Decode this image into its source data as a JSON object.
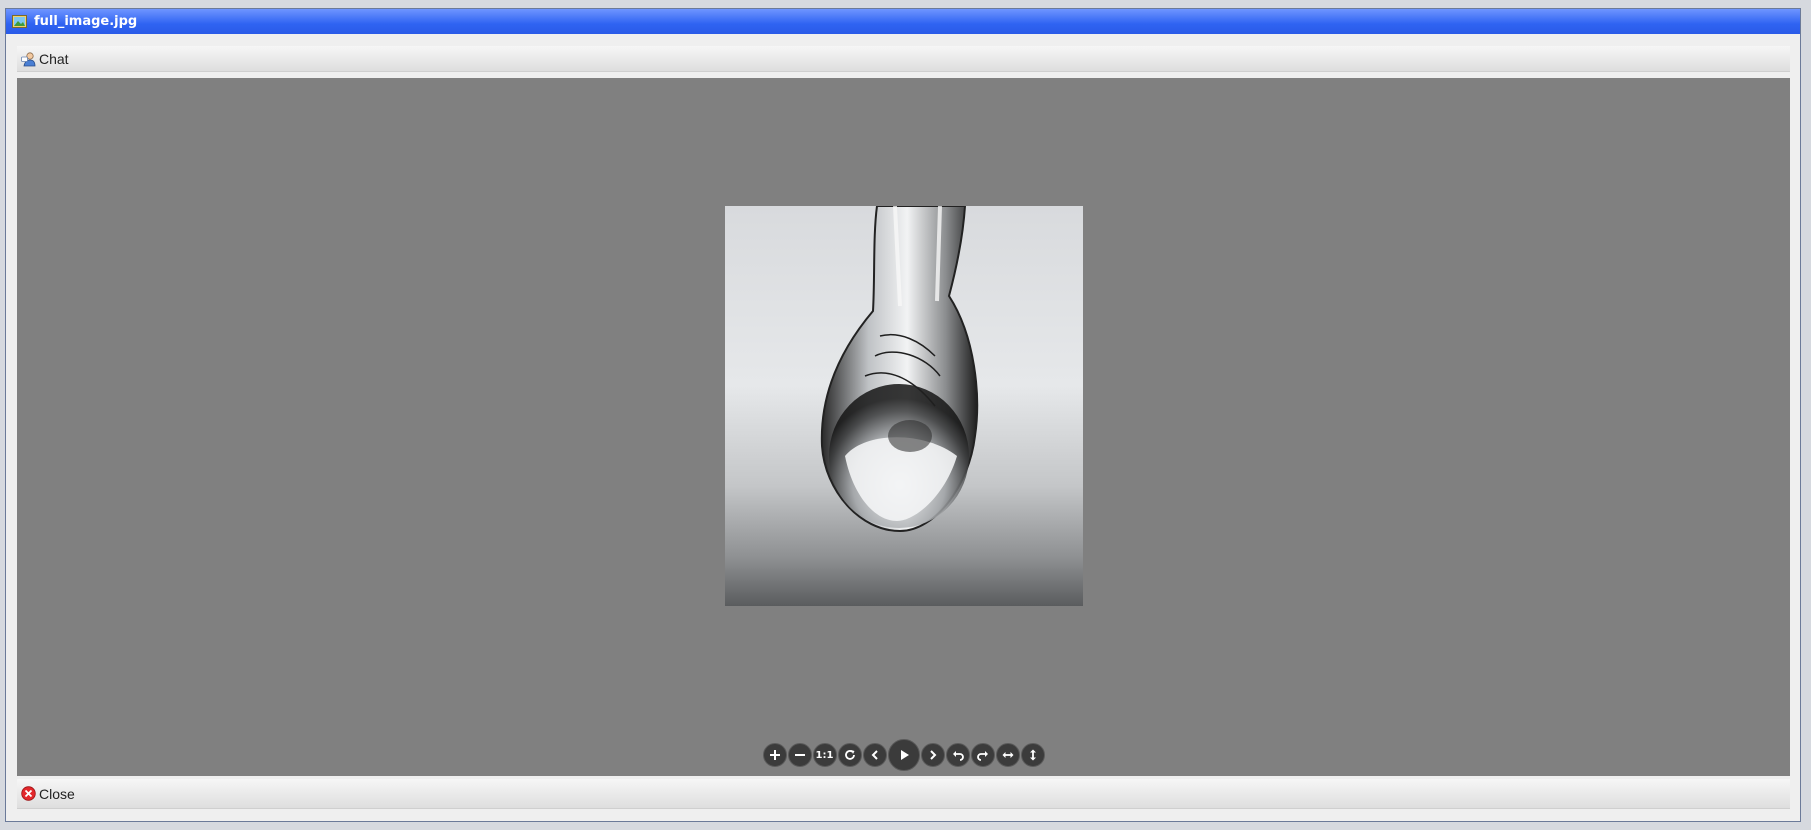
{
  "window": {
    "title": "full_image.jpg"
  },
  "toolbar": {
    "chat_label": "Chat"
  },
  "footer": {
    "close_label": "Close"
  },
  "viewer": {
    "controls": {
      "zoom_in": "plus-icon",
      "zoom_out": "minus-icon",
      "actual_size_label": "1:1",
      "reset": "refresh-icon",
      "prev": "chevron-left-icon",
      "play": "play-icon",
      "next": "chevron-right-icon",
      "rotate_left": "rotate-left-icon",
      "rotate_right": "rotate-right-icon",
      "flip_horizontal": "flip-horizontal-icon",
      "flip_vertical": "flip-vertical-icon"
    }
  }
}
